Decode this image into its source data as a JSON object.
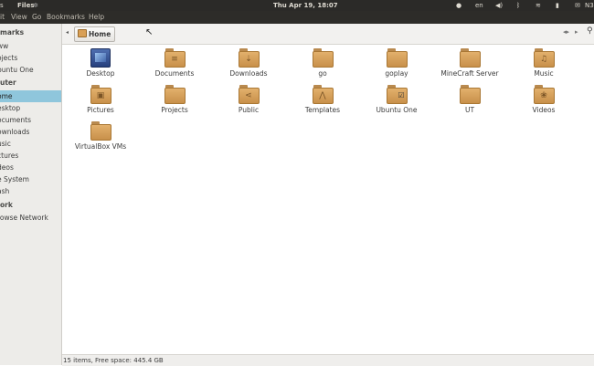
{
  "top_panel": {
    "app_name": "Files",
    "clock": "Thu Apr 19, 18:07",
    "keyboard": "en",
    "user": "N36"
  },
  "menubar": [
    "it",
    "View",
    "Go",
    "Bookmarks",
    "Help"
  ],
  "sidebar": {
    "sections": [
      {
        "heading": "marks",
        "items": [
          "ww",
          "ojects",
          "buntu One"
        ]
      },
      {
        "heading": "uter",
        "items": [
          "ome",
          "esktop",
          "ocuments",
          "ownloads",
          "usic",
          "ctures",
          "deos",
          "e System",
          "ash"
        ]
      },
      {
        "heading": "ork",
        "items": [
          "rowse Network"
        ]
      }
    ],
    "selected": "ome"
  },
  "toolbar": {
    "path_label": "Home"
  },
  "files": [
    {
      "name": "Desktop",
      "icon": "desktop-icon"
    },
    {
      "name": "Documents",
      "icon": "documents-folder-icon"
    },
    {
      "name": "Downloads",
      "icon": "downloads-folder-icon"
    },
    {
      "name": "go",
      "icon": "folder-icon"
    },
    {
      "name": "goplay",
      "icon": "folder-icon"
    },
    {
      "name": "MineCraft Server",
      "icon": "folder-icon"
    },
    {
      "name": "Music",
      "icon": "music-folder-icon"
    },
    {
      "name": "Pictures",
      "icon": "pictures-folder-icon"
    },
    {
      "name": "Projects",
      "icon": "folder-icon"
    },
    {
      "name": "Public",
      "icon": "public-folder-icon"
    },
    {
      "name": "Templates",
      "icon": "templates-folder-icon"
    },
    {
      "name": "Ubuntu One",
      "icon": "ubuntu-one-folder-icon"
    },
    {
      "name": "UT",
      "icon": "folder-icon"
    },
    {
      "name": "Videos",
      "icon": "videos-folder-icon"
    },
    {
      "name": "VirtualBox VMs",
      "icon": "folder-icon"
    }
  ],
  "status": "15 items, Free space: 445.4 GB"
}
